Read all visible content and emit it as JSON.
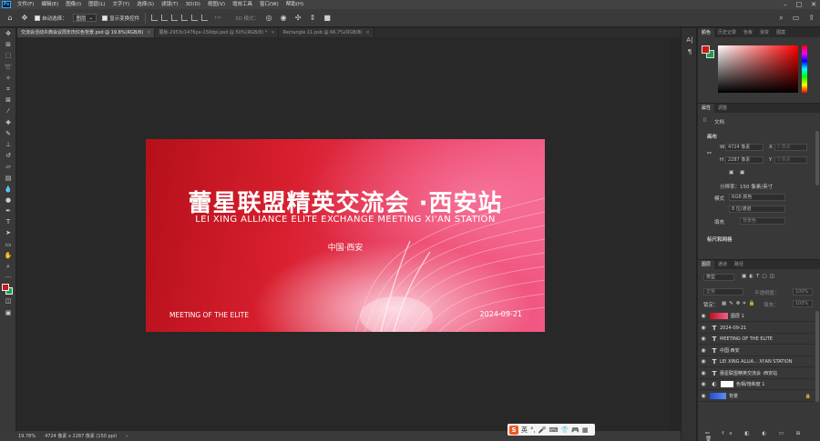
{
  "menu": [
    "文件(F)",
    "编辑(E)",
    "图像(I)",
    "图层(L)",
    "文字(Y)",
    "选择(S)",
    "滤镜(T)",
    "3D(D)",
    "视图(V)",
    "增效工具",
    "窗口(W)",
    "帮助(H)"
  ],
  "options": {
    "auto_select_label": "自动选择：",
    "auto_select_value": "图层",
    "show_transform_label": "显示变换控件",
    "mode3d_label": "3D 模式："
  },
  "tabs": [
    {
      "label": "交流会活动炎典会议周年庆红色背景.psd @ 19.8%(RGB/8)",
      "active": true
    },
    {
      "label": "展板-2953x1476px-150dpi.psd @ 50%(RGB/8) *",
      "active": false
    },
    {
      "label": "Rectangle 11.psb @ 66.7%(RGB/8)",
      "active": false
    }
  ],
  "artboard": {
    "title": "蕾星联盟精英交流会 ·西安站",
    "subtitle": "LEI XING ALLIANCE ELITE EXCHANGE MEETING XI'AN STATION",
    "city": "中国·西安",
    "meeting": "MEETING OF THE ELITE",
    "date": "2024-09-21"
  },
  "status": {
    "zoom": "19.78%",
    "doc_info": "4724 像素 x 2287 像素 (150 ppi)"
  },
  "ime": {
    "logo": "S",
    "lang": "英"
  },
  "color_panel": {
    "tabs": [
      "颜色",
      "历史记录",
      "色板",
      "渐变",
      "图案"
    ],
    "fg_color": "#cc1a1a",
    "bg_color": "#1b9e4b"
  },
  "properties": {
    "tabs": [
      "属性",
      "调整"
    ],
    "doc_label": "文档",
    "canvas_label": "画布",
    "w_label": "W",
    "w_value": "4724 像素",
    "h_label": "H",
    "h_value": "2287 像素",
    "x_label": "X",
    "x_placeholder": "0 像素",
    "y_label": "Y",
    "y_placeholder": "0 像素",
    "resolution": "分辨率：150 像素/英寸",
    "mode_label": "模式",
    "mode_value": "RGB 颜色",
    "depth_value": "8 位/通道",
    "fill_label": "填充",
    "fill_value": "背景色",
    "rulers_label": "标尺和网格"
  },
  "layers": {
    "tabs": [
      "图层",
      "通道",
      "路径"
    ],
    "kind_label": "类型",
    "blend_mode": "正常",
    "opacity_label": "不透明度：",
    "opacity_value": "100%",
    "lock_label": "锁定：",
    "fill_label": "填充：",
    "fill_value": "100%",
    "items": [
      {
        "name": "图层 1",
        "kind": "image"
      },
      {
        "name": "2024-09-21",
        "kind": "text"
      },
      {
        "name": "MEETING OF THE ELITE",
        "kind": "text"
      },
      {
        "name": "中国·西安",
        "kind": "text"
      },
      {
        "name": "LEI XING ALLIA... XI'AN STATION",
        "kind": "text"
      },
      {
        "name": "蕾星联盟精英交流会 ·西安站",
        "kind": "text"
      },
      {
        "name": "色相/饱和度 1",
        "kind": "adjust"
      },
      {
        "name": "背景",
        "kind": "background"
      }
    ]
  }
}
